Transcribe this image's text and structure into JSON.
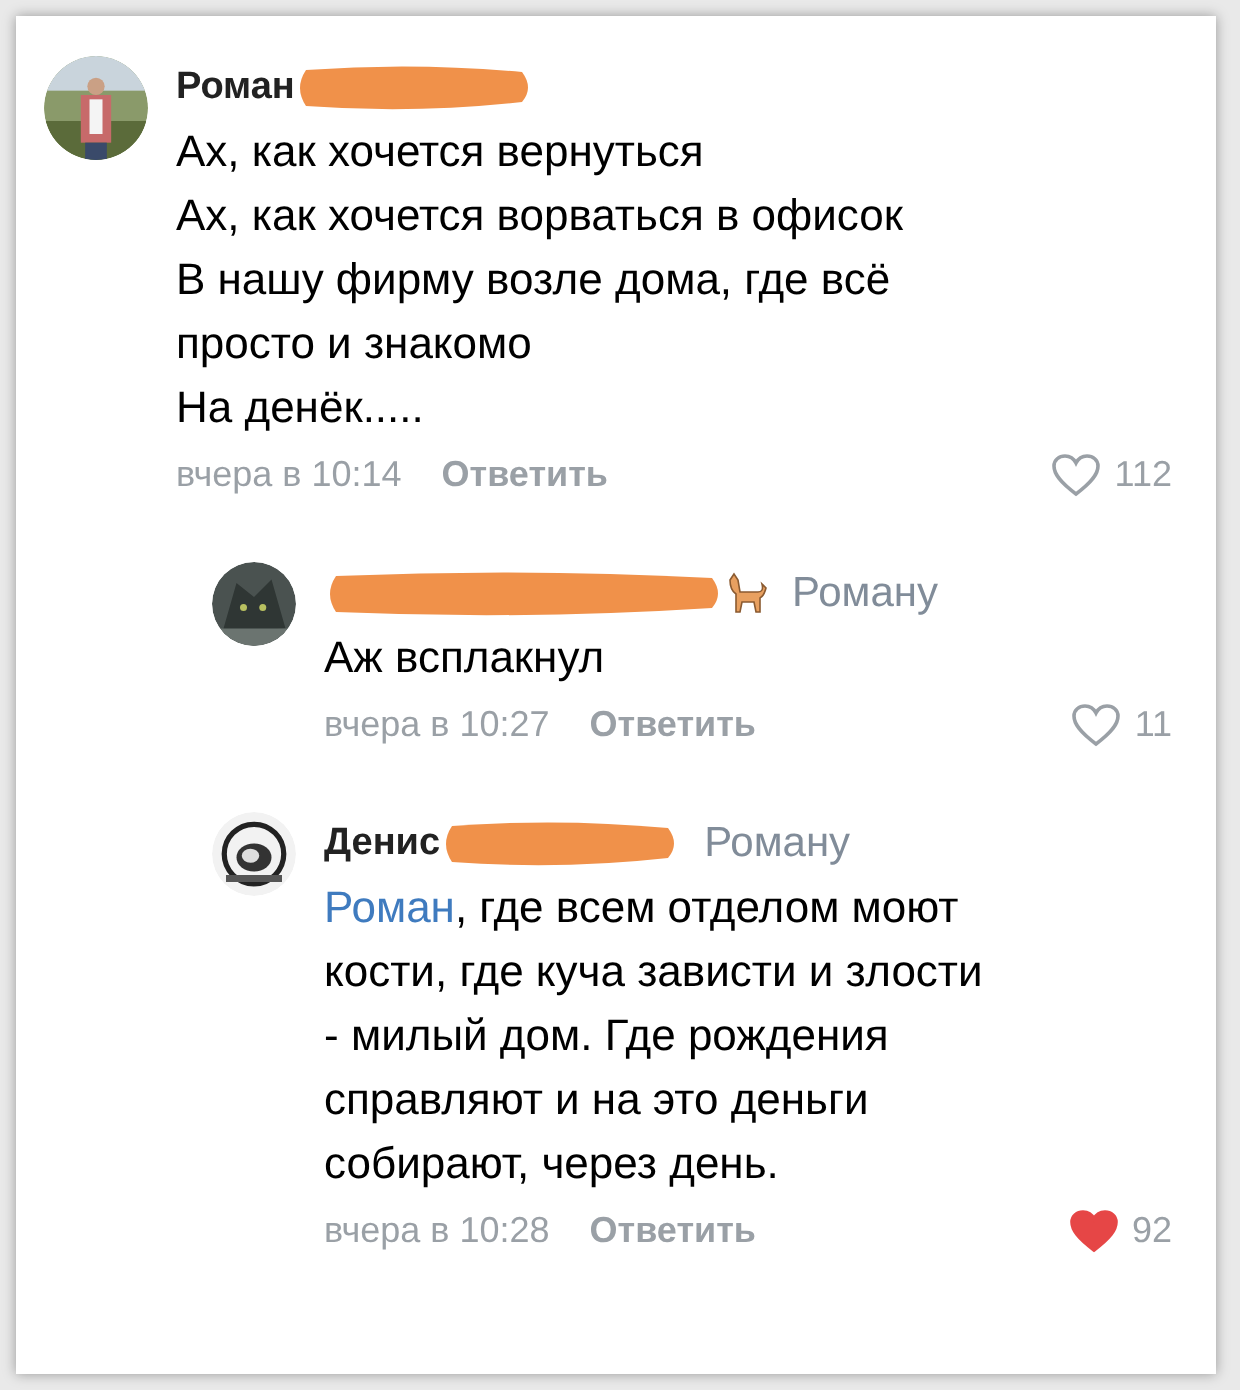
{
  "comments": [
    {
      "kind": "top",
      "name": "Роман",
      "text": "Ах, как хочется вернуться\nАх, как хочется ворваться в офисок\nВ нашу фирму возле дома, где всё\nпросто и знакомо\nНа денёк.....",
      "time": "вчера в 10:14",
      "reply_label": "Ответить",
      "likes": "112",
      "liked": false
    },
    {
      "kind": "reply",
      "reply_to": "Роману",
      "text": "Аж всплакнул",
      "time": "вчера в 10:27",
      "reply_label": "Ответить",
      "likes": "11",
      "liked": false,
      "cat_emoji": true
    },
    {
      "kind": "reply",
      "name": "Денис",
      "reply_to": "Роману",
      "mention": "Роман",
      "text": ", где всем отделом моют\nкости, где куча зависти и злости\n- милый дом. Где рождения\nсправляют и на это деньги\nсобирают, через день.",
      "time": "вчера в 10:28",
      "reply_label": "Ответить",
      "likes": "92",
      "liked": true
    }
  ]
}
